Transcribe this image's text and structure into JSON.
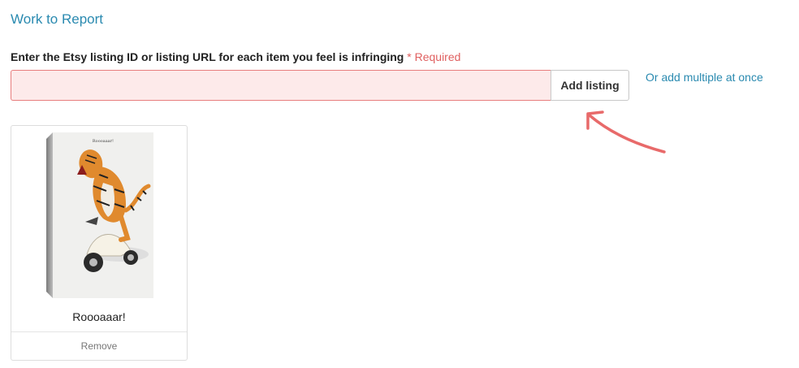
{
  "section": {
    "title": "Work to Report"
  },
  "form": {
    "label": "Enter the Etsy listing ID or listing URL for each item you feel is infringing",
    "required_text": "* Required",
    "input_value": "",
    "input_placeholder": "",
    "add_button_label": "Add listing",
    "multi_link_label": "Or add multiple at once"
  },
  "listings": [
    {
      "title": "Roooaaar!",
      "image_caption": "Roooaaar!",
      "remove_label": "Remove"
    }
  ],
  "colors": {
    "link": "#2a8ab0",
    "error": "#e06060",
    "error_bg": "#fdeaea",
    "arrow": "#e86a6a"
  }
}
